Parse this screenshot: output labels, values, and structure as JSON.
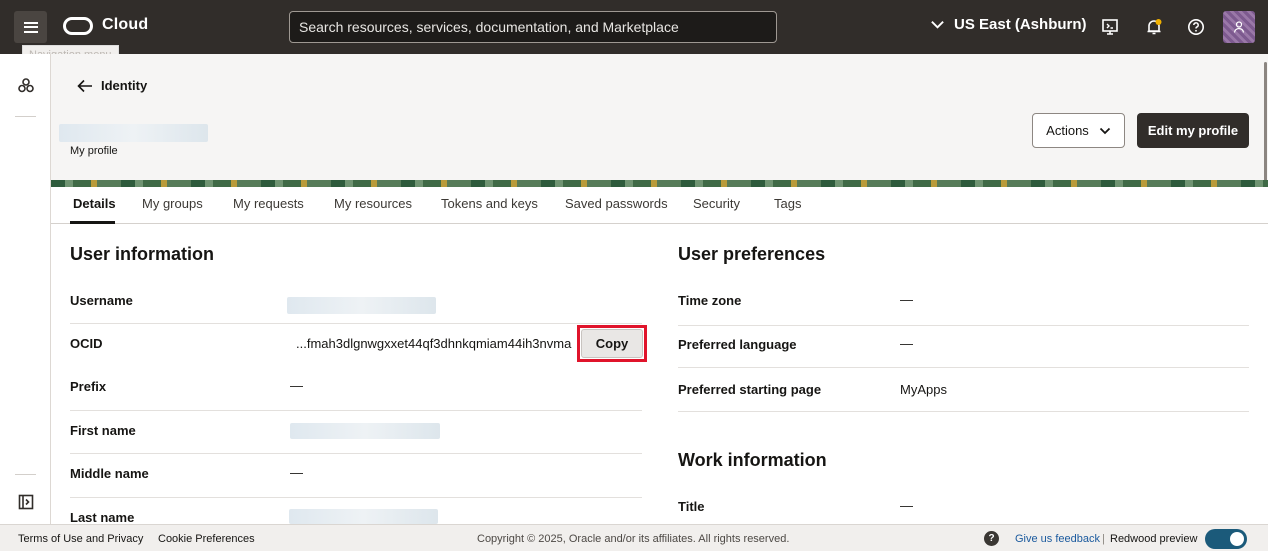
{
  "topbar": {
    "nav_tooltip": "Navigation menu",
    "brand": "Cloud",
    "search_placeholder": "Search resources, services, documentation, and Marketplace",
    "region": "US East (Ashburn)"
  },
  "header": {
    "back_label": "Identity",
    "profile_subtitle": "My profile",
    "actions_label": "Actions",
    "edit_label": "Edit my profile"
  },
  "tabs": [
    "Details",
    "My groups",
    "My requests",
    "My resources",
    "Tokens and keys",
    "Saved passwords",
    "Security",
    "Tags"
  ],
  "user_information": {
    "title": "User information",
    "rows": [
      {
        "label": "Username",
        "value": ""
      },
      {
        "label": "OCID",
        "value": "...fmah3dlgnwgxxet44qf3dhnkqmiam44ih3nvma"
      },
      {
        "label": "Prefix",
        "value": "—"
      },
      {
        "label": "First name",
        "value": ""
      },
      {
        "label": "Middle name",
        "value": "—"
      },
      {
        "label": "Last name",
        "value": ""
      }
    ],
    "copy_label": "Copy"
  },
  "user_preferences": {
    "title": "User preferences",
    "rows": [
      {
        "label": "Time zone",
        "value": "—"
      },
      {
        "label": "Preferred language",
        "value": "—"
      },
      {
        "label": "Preferred starting page",
        "value": "MyApps"
      }
    ]
  },
  "work_information": {
    "title": "Work information",
    "rows": [
      {
        "label": "Title",
        "value": "—"
      }
    ]
  },
  "footer": {
    "terms": "Terms of Use and Privacy",
    "cookies": "Cookie Preferences",
    "copyright": "Copyright © 2025, Oracle and/or its affiliates. All rights reserved.",
    "feedback": "Give us feedback",
    "divider": "|",
    "redwood": "Redwood preview"
  },
  "colors": {
    "topbar": "#312d2a",
    "highlight": "#e0142b",
    "toggle": "#1b5a7a"
  }
}
